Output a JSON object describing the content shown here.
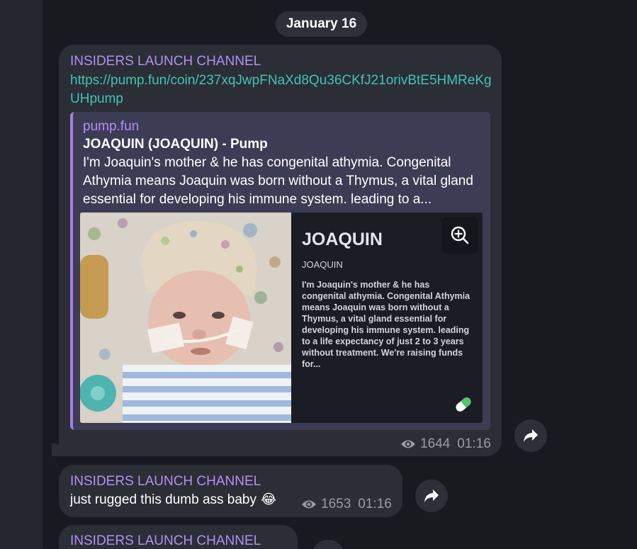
{
  "date_separator": "January 16",
  "messages": [
    {
      "sender": "INSIDERS LAUNCH CHANNEL",
      "link": "https://pump.fun/coin/237xqJwpFNaXd8Qu36CKfJ21orivBtE5HMReKgUHpump",
      "preview": {
        "site": "pump.fun",
        "title": "JOAQUIN (JOAQUIN) - Pump",
        "description": "I'm Joaquin's mother & he has congenital athymia. Congenital Athymia means Joaquin was born without a Thymus, a vital gland essential for developing his immune system. leading to a...",
        "card": {
          "name": "JOAQUIN",
          "ticker": "JOAQUIN",
          "description": "I'm Joaquin's mother & he has congenital athymia. Congenital Athymia means Joaquin was born without a Thymus, a vital gland essential for developing his immune system. leading to a life expectancy of just 2 to 3 years without treatment. We're raising funds for..."
        }
      },
      "views": "1644",
      "time": "01:16"
    },
    {
      "sender": "INSIDERS LAUNCH CHANNEL",
      "text": "just rugged this dumb ass baby",
      "emoji": "😂",
      "views": "1653",
      "time": "01:16"
    },
    {
      "sender": "INSIDERS LAUNCH CHANNEL"
    }
  ],
  "icons": {
    "views": "eye-icon",
    "share": "share-arrow-icon",
    "zoom": "zoom-in-icon",
    "pill": "pill-icon"
  },
  "colors": {
    "sender": "#b38ff5",
    "link": "#43c3b4",
    "preview_accent": "#a87ee7",
    "bubble": "#2b2e35",
    "background": "#181a1f"
  }
}
